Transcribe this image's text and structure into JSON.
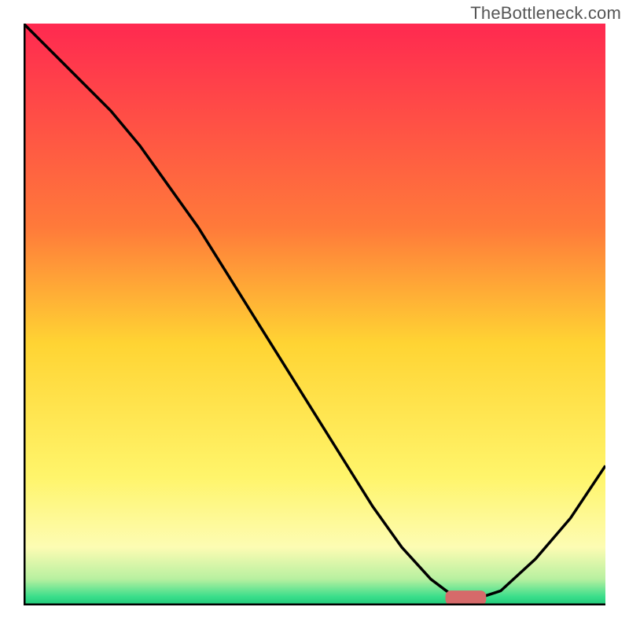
{
  "watermark": "TheBottleneck.com",
  "chart_data": {
    "type": "line",
    "title": "",
    "xlabel": "",
    "ylabel": "",
    "xlim": [
      0,
      100
    ],
    "ylim": [
      0,
      100
    ],
    "grid": false,
    "legend": false,
    "background_gradient": {
      "stops": [
        {
          "offset": 0.0,
          "color": "#ff2950"
        },
        {
          "offset": 0.35,
          "color": "#ff7a3a"
        },
        {
          "offset": 0.55,
          "color": "#ffd433"
        },
        {
          "offset": 0.78,
          "color": "#fff56b"
        },
        {
          "offset": 0.9,
          "color": "#fdfcb3"
        },
        {
          "offset": 0.955,
          "color": "#b7f0a0"
        },
        {
          "offset": 0.985,
          "color": "#3ade8b"
        },
        {
          "offset": 1.0,
          "color": "#1fc878"
        }
      ]
    },
    "series": [
      {
        "name": "bottleneck-curve",
        "x": [
          0,
          5,
          10,
          15,
          20,
          25,
          30,
          35,
          40,
          45,
          50,
          55,
          60,
          65,
          70,
          74,
          78,
          82,
          88,
          94,
          100
        ],
        "y": [
          100,
          95,
          90,
          85,
          79,
          72,
          65,
          57,
          49,
          41,
          33,
          25,
          17,
          10,
          4.5,
          1.5,
          1.2,
          2.5,
          8,
          15,
          24
        ]
      }
    ],
    "marker": {
      "name": "highlight-range",
      "x_center": 76,
      "y": 1.3,
      "width": 7,
      "height": 2.5,
      "color": "#d66a6a"
    }
  }
}
